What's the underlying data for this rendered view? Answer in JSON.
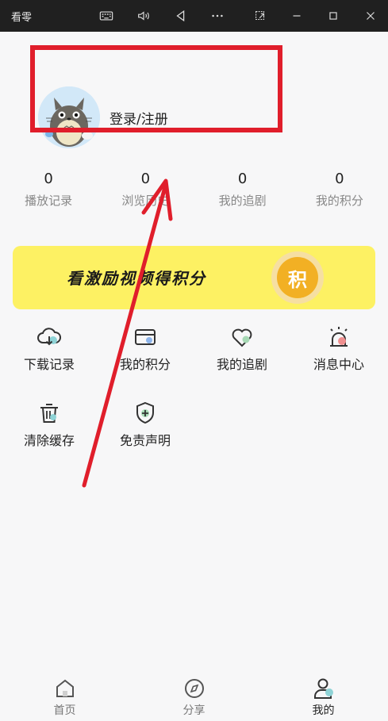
{
  "window": {
    "title": "看零"
  },
  "profile": {
    "login_label": "登录/注册"
  },
  "stats": [
    {
      "value": "0",
      "label": "播放记录"
    },
    {
      "value": "0",
      "label": "浏览历史"
    },
    {
      "value": "0",
      "label": "我的追剧"
    },
    {
      "value": "0",
      "label": "我的积分"
    }
  ],
  "banner": {
    "text": "看激励视频得积分",
    "coin_label": "积"
  },
  "menu": [
    {
      "label": "下载记录",
      "icon": "cloud-download-icon"
    },
    {
      "label": "我的积分",
      "icon": "card-icon"
    },
    {
      "label": "我的追剧",
      "icon": "heart-icon"
    },
    {
      "label": "消息中心",
      "icon": "alarm-icon"
    },
    {
      "label": "清除缓存",
      "icon": "trash-icon"
    },
    {
      "label": "免责声明",
      "icon": "shield-icon"
    }
  ],
  "tabs": [
    {
      "label": "首页",
      "icon": "home-icon"
    },
    {
      "label": "分享",
      "icon": "compass-icon"
    },
    {
      "label": "我的",
      "icon": "user-icon"
    }
  ],
  "colors": {
    "accent_red": "#e01e2b",
    "banner_yellow": "#fdf163",
    "coin_orange": "#f2b024",
    "icon_teal": "#8fd3d6"
  }
}
